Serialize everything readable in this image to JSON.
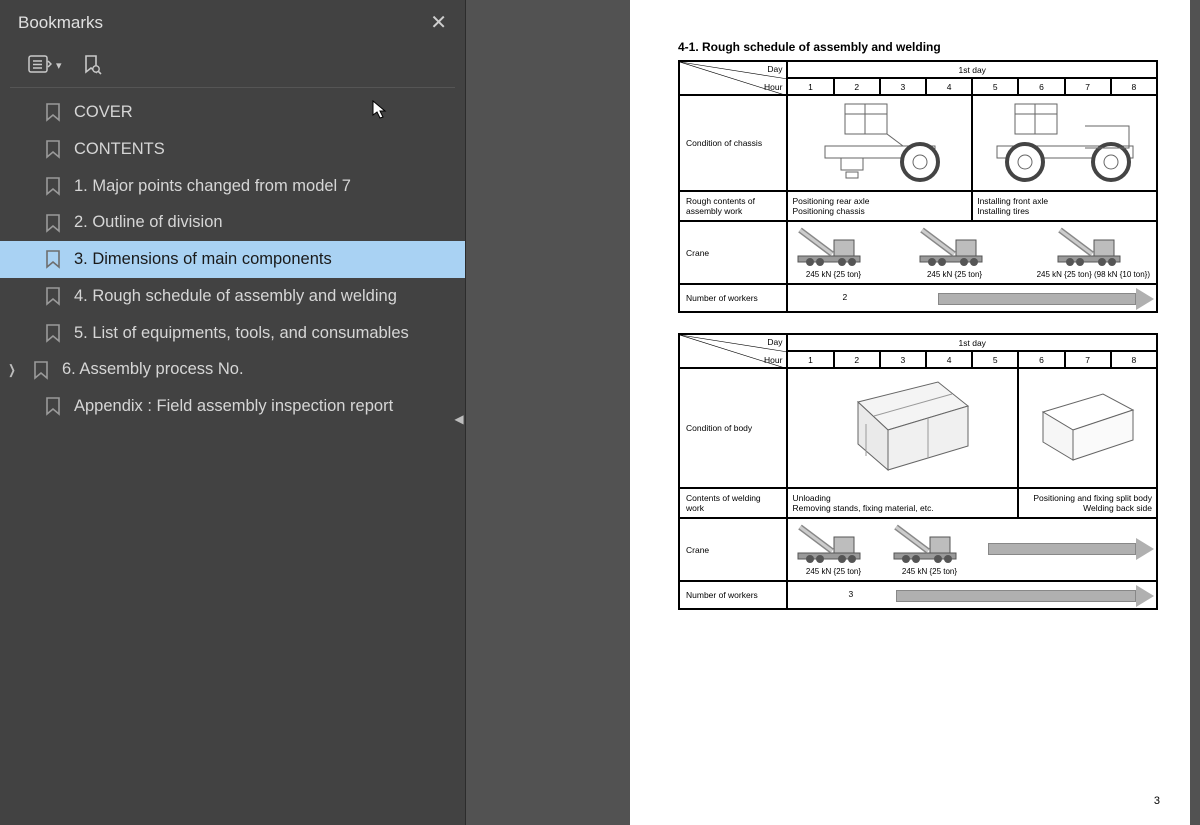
{
  "sidebar": {
    "title": "Bookmarks",
    "items": [
      {
        "label": "COVER",
        "expandable": false
      },
      {
        "label": "CONTENTS",
        "expandable": false
      },
      {
        "label": "1. Major points changed from model 7",
        "expandable": false
      },
      {
        "label": "2. Outline of division",
        "expandable": false
      },
      {
        "label": "3. Dimensions of main components",
        "expandable": false,
        "selected": true
      },
      {
        "label": "4. Rough schedule of assembly and welding",
        "expandable": false
      },
      {
        "label": "5. List of equipments, tools, and consumables",
        "expandable": false
      },
      {
        "label": "6. Assembly process No.",
        "expandable": true
      },
      {
        "label": "Appendix : Field assembly inspection report",
        "expandable": false
      }
    ]
  },
  "doc": {
    "section_title": "4-1.  Rough schedule of assembly and welding",
    "page_number": "3",
    "corner": {
      "day": "Day",
      "hour": "Hour"
    },
    "day_label": "1st day",
    "hours": [
      "1",
      "2",
      "3",
      "4",
      "5",
      "6",
      "7",
      "8"
    ],
    "table1": {
      "rows": {
        "r1": "Condition of chassis",
        "r2": "Rough contents of assembly work",
        "r3": "Crane",
        "r4": "Number of workers"
      },
      "assembly_left": "Positioning rear axle\nPositioning chassis",
      "assembly_right": "Installing front axle\nInstalling tires",
      "crane_a": "245 kN {25 ton}",
      "crane_b": "245 kN {25 ton}",
      "crane_c": "245 kN {25 ton} (98 kN {10 ton})",
      "workers": "2"
    },
    "table2": {
      "rows": {
        "r1": "Condition of body",
        "r2": "Contents of welding work",
        "r3": "Crane",
        "r4": "Number of workers"
      },
      "weld_left": "Unloading\nRemoving stands, fixing material, etc.",
      "weld_right": "Positioning and fixing split body\nWelding back side",
      "crane_a": "245 kN {25 ton}",
      "crane_b": "245 kN {25 ton}",
      "workers": "3"
    }
  }
}
